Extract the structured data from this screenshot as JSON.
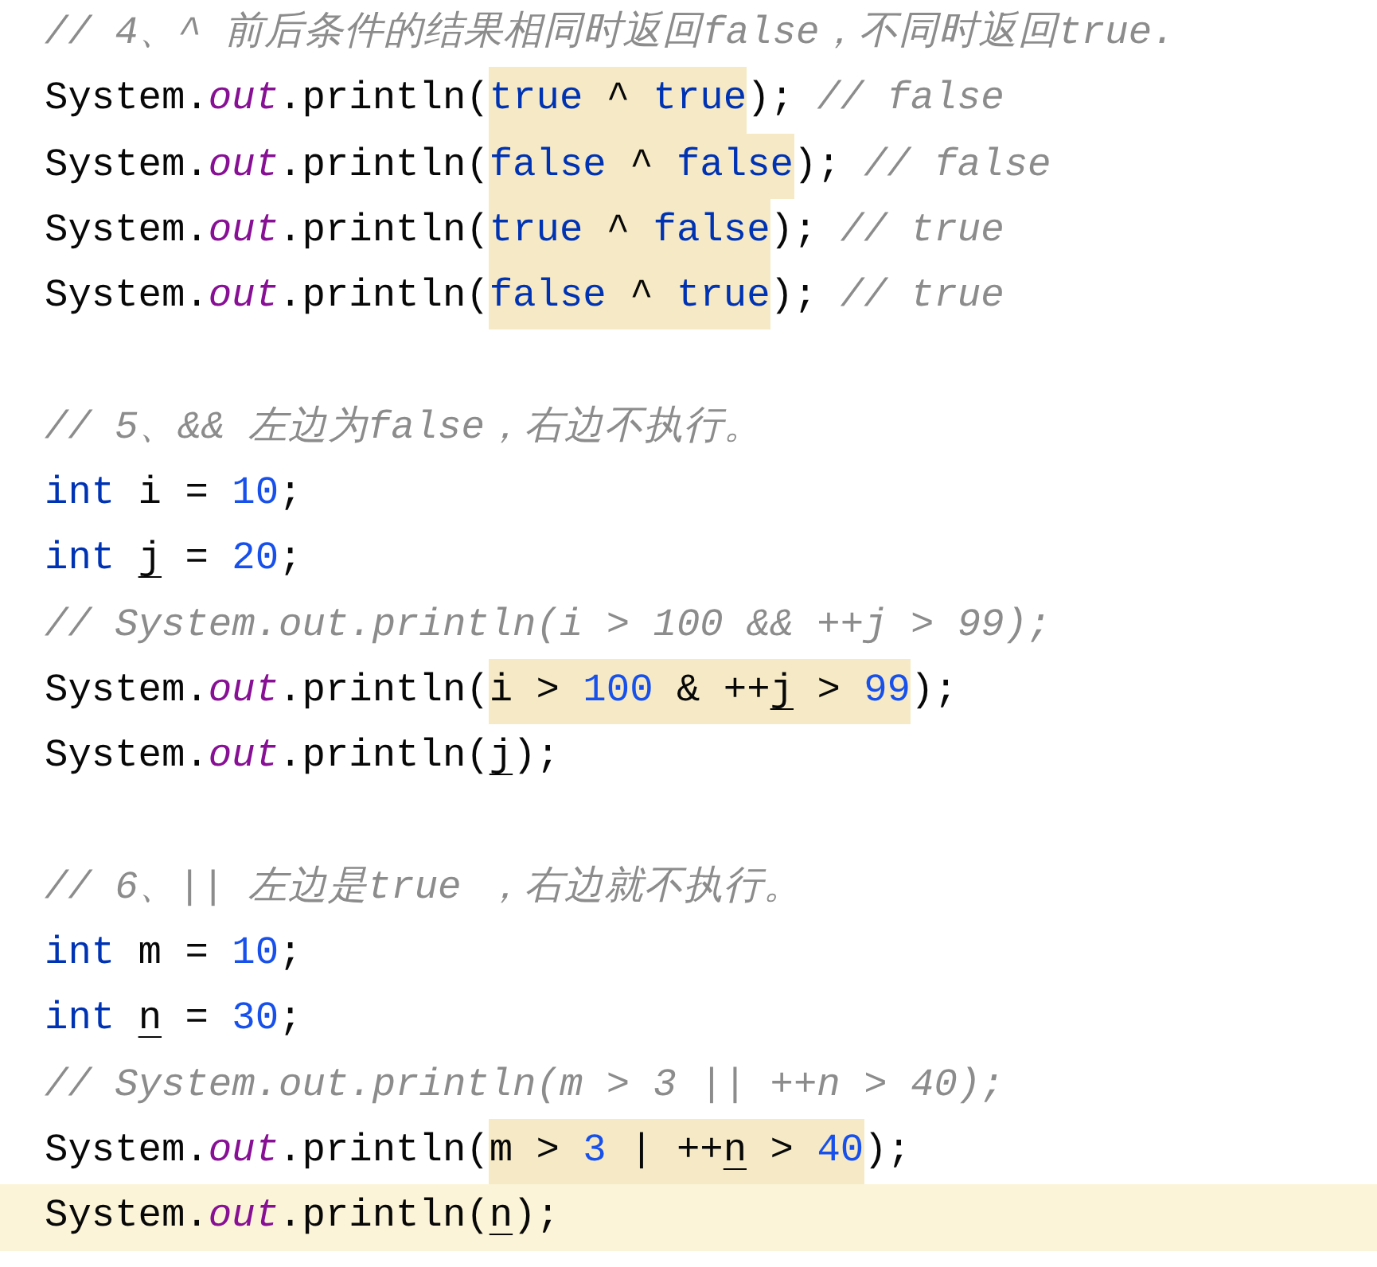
{
  "editor": {
    "lines": [
      {
        "kind": "code",
        "current": false,
        "tokens": [
          {
            "text": "// 4、^ 前后条件的结果相同时返回false，不同时返回true.",
            "kind": "comment",
            "highlighted": false,
            "underlined": false
          }
        ]
      },
      {
        "kind": "code",
        "current": false,
        "tokens": [
          {
            "text": "System.",
            "kind": "plain",
            "highlighted": false,
            "underlined": false
          },
          {
            "text": "out",
            "kind": "field",
            "highlighted": false,
            "underlined": false
          },
          {
            "text": ".println(",
            "kind": "plain",
            "highlighted": false,
            "underlined": false
          },
          {
            "text": "true",
            "kind": "keyword",
            "highlighted": true,
            "underlined": false
          },
          {
            "text": " ^ ",
            "kind": "plain",
            "highlighted": true,
            "underlined": false
          },
          {
            "text": "true",
            "kind": "keyword",
            "highlighted": true,
            "underlined": false
          },
          {
            "text": "); ",
            "kind": "plain",
            "highlighted": false,
            "underlined": false
          },
          {
            "text": "// false",
            "kind": "comment",
            "highlighted": false,
            "underlined": false
          }
        ]
      },
      {
        "kind": "code",
        "current": false,
        "tokens": [
          {
            "text": "System.",
            "kind": "plain",
            "highlighted": false,
            "underlined": false
          },
          {
            "text": "out",
            "kind": "field",
            "highlighted": false,
            "underlined": false
          },
          {
            "text": ".println(",
            "kind": "plain",
            "highlighted": false,
            "underlined": false
          },
          {
            "text": "false",
            "kind": "keyword",
            "highlighted": true,
            "underlined": false
          },
          {
            "text": " ^ ",
            "kind": "plain",
            "highlighted": true,
            "underlined": false
          },
          {
            "text": "false",
            "kind": "keyword",
            "highlighted": true,
            "underlined": false
          },
          {
            "text": "); ",
            "kind": "plain",
            "highlighted": false,
            "underlined": false
          },
          {
            "text": "// false",
            "kind": "comment",
            "highlighted": false,
            "underlined": false
          }
        ]
      },
      {
        "kind": "code",
        "current": false,
        "tokens": [
          {
            "text": "System.",
            "kind": "plain",
            "highlighted": false,
            "underlined": false
          },
          {
            "text": "out",
            "kind": "field",
            "highlighted": false,
            "underlined": false
          },
          {
            "text": ".println(",
            "kind": "plain",
            "highlighted": false,
            "underlined": false
          },
          {
            "text": "true",
            "kind": "keyword",
            "highlighted": true,
            "underlined": false
          },
          {
            "text": " ^ ",
            "kind": "plain",
            "highlighted": true,
            "underlined": false
          },
          {
            "text": "false",
            "kind": "keyword",
            "highlighted": true,
            "underlined": false
          },
          {
            "text": "); ",
            "kind": "plain",
            "highlighted": false,
            "underlined": false
          },
          {
            "text": "// true",
            "kind": "comment",
            "highlighted": false,
            "underlined": false
          }
        ]
      },
      {
        "kind": "code",
        "current": false,
        "tokens": [
          {
            "text": "System.",
            "kind": "plain",
            "highlighted": false,
            "underlined": false
          },
          {
            "text": "out",
            "kind": "field",
            "highlighted": false,
            "underlined": false
          },
          {
            "text": ".println(",
            "kind": "plain",
            "highlighted": false,
            "underlined": false
          },
          {
            "text": "false",
            "kind": "keyword",
            "highlighted": true,
            "underlined": false
          },
          {
            "text": " ^ ",
            "kind": "plain",
            "highlighted": true,
            "underlined": false
          },
          {
            "text": "true",
            "kind": "keyword",
            "highlighted": true,
            "underlined": false
          },
          {
            "text": "); ",
            "kind": "plain",
            "highlighted": false,
            "underlined": false
          },
          {
            "text": "// true",
            "kind": "comment",
            "highlighted": false,
            "underlined": false
          }
        ]
      },
      {
        "kind": "blank",
        "current": false
      },
      {
        "kind": "code",
        "current": false,
        "tokens": [
          {
            "text": "// 5、&& 左边为false，右边不执行。",
            "kind": "comment",
            "highlighted": false,
            "underlined": false
          }
        ]
      },
      {
        "kind": "code",
        "current": false,
        "tokens": [
          {
            "text": "int",
            "kind": "keyword",
            "highlighted": false,
            "underlined": false
          },
          {
            "text": " i = ",
            "kind": "plain",
            "highlighted": false,
            "underlined": false
          },
          {
            "text": "10",
            "kind": "number",
            "highlighted": false,
            "underlined": false
          },
          {
            "text": ";",
            "kind": "plain",
            "highlighted": false,
            "underlined": false
          }
        ]
      },
      {
        "kind": "code",
        "current": false,
        "tokens": [
          {
            "text": "int ",
            "kind": "keyword",
            "highlighted": false,
            "underlined": false
          },
          {
            "text": "j",
            "kind": "plain",
            "highlighted": false,
            "underlined": true
          },
          {
            "text": " = ",
            "kind": "plain",
            "highlighted": false,
            "underlined": false
          },
          {
            "text": "20",
            "kind": "number",
            "highlighted": false,
            "underlined": false
          },
          {
            "text": ";",
            "kind": "plain",
            "highlighted": false,
            "underlined": false
          }
        ]
      },
      {
        "kind": "code",
        "current": false,
        "tokens": [
          {
            "text": "// System.out.println(i > 100 && ++j > 99);",
            "kind": "comment",
            "highlighted": false,
            "underlined": false
          }
        ]
      },
      {
        "kind": "code",
        "current": false,
        "tokens": [
          {
            "text": "System.",
            "kind": "plain",
            "highlighted": false,
            "underlined": false
          },
          {
            "text": "out",
            "kind": "field",
            "highlighted": false,
            "underlined": false
          },
          {
            "text": ".println(",
            "kind": "plain",
            "highlighted": false,
            "underlined": false
          },
          {
            "text": "i > ",
            "kind": "plain",
            "highlighted": true,
            "underlined": false
          },
          {
            "text": "100",
            "kind": "number",
            "highlighted": true,
            "underlined": false
          },
          {
            "text": " & ++",
            "kind": "plain",
            "highlighted": true,
            "underlined": false
          },
          {
            "text": "j",
            "kind": "plain",
            "highlighted": true,
            "underlined": true
          },
          {
            "text": " > ",
            "kind": "plain",
            "highlighted": true,
            "underlined": false
          },
          {
            "text": "99",
            "kind": "number",
            "highlighted": true,
            "underlined": false
          },
          {
            "text": ");",
            "kind": "plain",
            "highlighted": false,
            "underlined": false
          }
        ]
      },
      {
        "kind": "code",
        "current": false,
        "tokens": [
          {
            "text": "System.",
            "kind": "plain",
            "highlighted": false,
            "underlined": false
          },
          {
            "text": "out",
            "kind": "field",
            "highlighted": false,
            "underlined": false
          },
          {
            "text": ".println(",
            "kind": "plain",
            "highlighted": false,
            "underlined": false
          },
          {
            "text": "j",
            "kind": "plain",
            "highlighted": false,
            "underlined": true
          },
          {
            "text": ");",
            "kind": "plain",
            "highlighted": false,
            "underlined": false
          }
        ]
      },
      {
        "kind": "blank",
        "current": false
      },
      {
        "kind": "code",
        "current": false,
        "tokens": [
          {
            "text": "// 6、|| 左边是true ，右边就不执行。",
            "kind": "comment",
            "highlighted": false,
            "underlined": false
          }
        ]
      },
      {
        "kind": "code",
        "current": false,
        "tokens": [
          {
            "text": "int",
            "kind": "keyword",
            "highlighted": false,
            "underlined": false
          },
          {
            "text": " m = ",
            "kind": "plain",
            "highlighted": false,
            "underlined": false
          },
          {
            "text": "10",
            "kind": "number",
            "highlighted": false,
            "underlined": false
          },
          {
            "text": ";",
            "kind": "plain",
            "highlighted": false,
            "underlined": false
          }
        ]
      },
      {
        "kind": "code",
        "current": false,
        "tokens": [
          {
            "text": "int ",
            "kind": "keyword",
            "highlighted": false,
            "underlined": false
          },
          {
            "text": "n",
            "kind": "plain",
            "highlighted": false,
            "underlined": true
          },
          {
            "text": " = ",
            "kind": "plain",
            "highlighted": false,
            "underlined": false
          },
          {
            "text": "30",
            "kind": "number",
            "highlighted": false,
            "underlined": false
          },
          {
            "text": ";",
            "kind": "plain",
            "highlighted": false,
            "underlined": false
          }
        ]
      },
      {
        "kind": "code",
        "current": false,
        "tokens": [
          {
            "text": "// System.out.println(m > 3 || ++n > 40);",
            "kind": "comment",
            "highlighted": false,
            "underlined": false
          }
        ]
      },
      {
        "kind": "code",
        "current": false,
        "tokens": [
          {
            "text": "System.",
            "kind": "plain",
            "highlighted": false,
            "underlined": false
          },
          {
            "text": "out",
            "kind": "field",
            "highlighted": false,
            "underlined": false
          },
          {
            "text": ".println(",
            "kind": "plain",
            "highlighted": false,
            "underlined": false
          },
          {
            "text": "m > ",
            "kind": "plain",
            "highlighted": true,
            "underlined": false
          },
          {
            "text": "3",
            "kind": "number",
            "highlighted": true,
            "underlined": false
          },
          {
            "text": " | ++",
            "kind": "plain",
            "highlighted": true,
            "underlined": false
          },
          {
            "text": "n",
            "kind": "plain",
            "highlighted": true,
            "underlined": true
          },
          {
            "text": " > ",
            "kind": "plain",
            "highlighted": true,
            "underlined": false
          },
          {
            "text": "40",
            "kind": "number",
            "highlighted": true,
            "underlined": false
          },
          {
            "text": ");",
            "kind": "plain",
            "highlighted": false,
            "underlined": false
          }
        ]
      },
      {
        "kind": "code",
        "current": true,
        "tokens": [
          {
            "text": "System.",
            "kind": "plain",
            "highlighted": false,
            "underlined": false
          },
          {
            "text": "out",
            "kind": "field",
            "highlighted": false,
            "underlined": false
          },
          {
            "text": ".println(",
            "kind": "plain",
            "highlighted": false,
            "underlined": false
          },
          {
            "text": "n",
            "kind": "plain",
            "highlighted": false,
            "underlined": true
          },
          {
            "text": ");",
            "kind": "plain",
            "highlighted": false,
            "underlined": false
          }
        ]
      }
    ]
  }
}
